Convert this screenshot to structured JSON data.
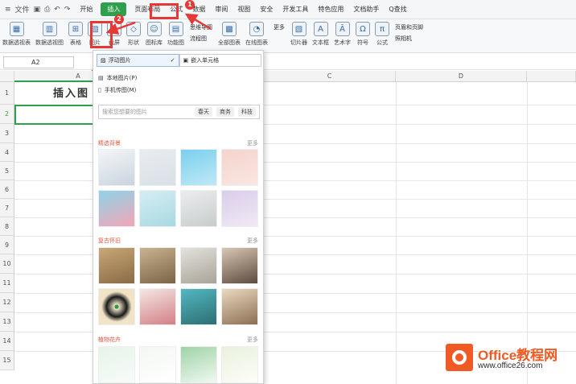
{
  "menubar": {
    "menu_label": "文件",
    "tabs": [
      "开始",
      "插入",
      "页面布局",
      "公式",
      "数据",
      "审阅",
      "视图",
      "安全",
      "开发工具",
      "特色应用",
      "文档助手"
    ],
    "search": "Q查找"
  },
  "ribbon": {
    "items": [
      "数据透视表",
      "数据透视图",
      "表格",
      "图片",
      "截屏",
      "形状",
      "图标库",
      "功能图",
      "流程图",
      "全部图表",
      "在线图表",
      "切片器",
      "文本框",
      "艺术字",
      "符号",
      "公式"
    ],
    "small": [
      "思维导图",
      "更多",
      "页眉和页脚",
      "照相机"
    ]
  },
  "formula": {
    "cell_ref": "A2"
  },
  "columns": [
    "A",
    "C",
    "D"
  ],
  "rows": [
    "1",
    "2",
    "3",
    "4",
    "5",
    "6",
    "7",
    "8",
    "9",
    "10",
    "11",
    "12",
    "13",
    "14",
    "15"
  ],
  "cell_a1": "插入图",
  "panel": {
    "float_label": "浮动图片",
    "embed_label": "嵌入单元格",
    "local_label": "本地图片(P)",
    "phone_label": "手机传图(M)",
    "search_placeholder": "搜索您想要的图片",
    "tags": [
      "春天",
      "商务",
      "科技"
    ],
    "sections": [
      {
        "title": "精选背景",
        "more": "更多"
      },
      {
        "title": "复古怀旧",
        "more": "更多"
      },
      {
        "title": "植物花卉",
        "more": "更多"
      }
    ]
  },
  "annotations": [
    "1",
    "2",
    "3"
  ],
  "watermark": {
    "title": "Office教程网",
    "url": "www.office26.com"
  },
  "colors": {
    "accent": "#2ea04b",
    "highlight": "#e53935",
    "brand": "#f05a24"
  }
}
